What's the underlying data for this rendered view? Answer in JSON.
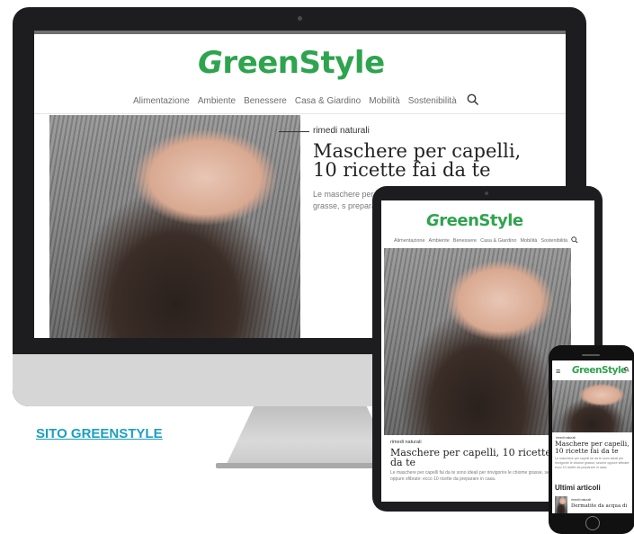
{
  "brand": {
    "logo_prefix": "G",
    "logo_rest": "reenStyle",
    "color": "#2ea44f"
  },
  "nav": {
    "items": [
      "Alimentazione",
      "Ambiente",
      "Benessere",
      "Casa & Giardino",
      "Mobilità",
      "Sostenibilità"
    ],
    "search_icon": "search-icon"
  },
  "desktop": {
    "kicker": "rimedi naturali",
    "title": "Maschere per capelli, 10 ricette fai da te",
    "excerpt": "Le maschere per chiome grasse, s preparare in casa"
  },
  "tablet": {
    "kicker": "rimedi naturali",
    "title": "Maschere per capelli, 10 ricette fai da te",
    "excerpt": "Le maschere per capelli fai da te sono ideali per rinvigorire le chiome grasse, secche oppure sfibrate: ecco 10 ricette da preparare in casa."
  },
  "phone": {
    "menu_icon": "menu-icon",
    "kicker": "rimedi naturali",
    "title": "Maschere per capelli, 10 ricette fai da te",
    "excerpt": "Le maschere per capelli fai da te sono ideali per rinvigorire le chiome grasse, secche oppure sfibrate: ecco 10 ricette da preparare in casa.",
    "section_title": "Ultimi articoli",
    "item_kicker": "rimedi naturali",
    "item_title": "Dermatite da acqua di"
  },
  "link": {
    "label": "SITO GREENSTYLE",
    "color": "#1a9fc1"
  }
}
